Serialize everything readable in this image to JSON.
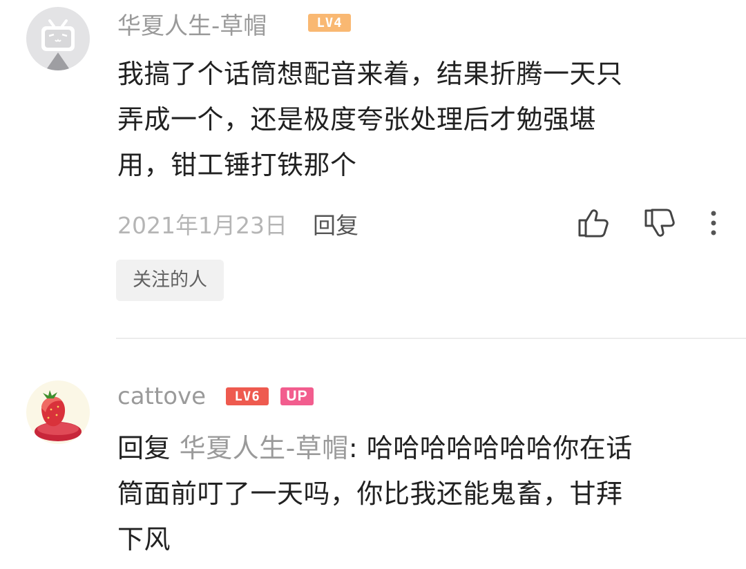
{
  "comments": [
    {
      "username": "华夏人生-草帽",
      "level": "LV4",
      "avatar_icon": "bilibili-tv-default-avatar-icon",
      "content_lines": [
        "我搞了个话筒想配音来着，结果折腾一天只",
        "弄成一个，还是极度夸张处理后才勉强堪",
        "用，钳工锤打铁那个"
      ],
      "date": "2021年1月23日",
      "reply_label": "回复",
      "tag": "关注的人"
    },
    {
      "username": "cattove",
      "level": "LV6",
      "badge": "UP",
      "avatar_icon": "strawberry-avatar-icon",
      "reply_prefix": "回复 ",
      "reply_to": "华夏人生-草帽",
      "content_lines": [
        ": 哈哈哈哈哈哈哈你在话",
        "筒面前叮了一天吗，你比我还能鬼畜，甘拜",
        "下风"
      ]
    }
  ],
  "icons": {
    "like": "thumb-up-icon",
    "dislike": "thumb-down-icon",
    "more": "more-vertical-icon"
  },
  "colors": {
    "lv4": "#f9b872",
    "lv6": "#ee5a4f",
    "up": "#f25d8e",
    "meta_text": "#9a9a9a"
  }
}
